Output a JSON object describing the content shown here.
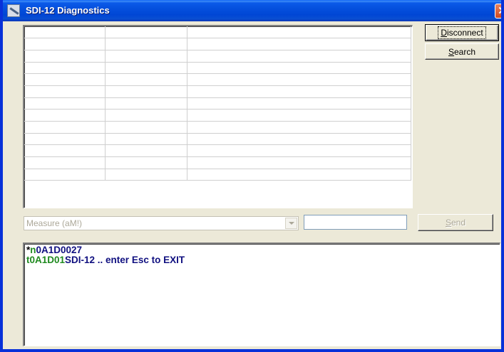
{
  "window": {
    "title": "SDI-12 Diagnostics",
    "close_glyph": "✕",
    "app_icon": "sdi12-app-icon"
  },
  "sensor_grid": {
    "columns": [
      "",
      "",
      ""
    ],
    "rows": 13
  },
  "buttons": {
    "disconnect": {
      "first": "D",
      "rest": "isconnect"
    },
    "search": {
      "first": "S",
      "rest": "earch"
    },
    "send": {
      "first": "S",
      "rest": "end"
    }
  },
  "command": {
    "selected": "Measure (aM!)",
    "parameter_value": ""
  },
  "terminal": {
    "lines": [
      [
        {
          "text": "*",
          "color": "#000000"
        },
        {
          "text": "n",
          "color": "#1f8a1f"
        },
        {
          "text": "0A1D0027",
          "color": "#101080"
        }
      ],
      [
        {
          "text": "t0A1D01",
          "color": "#1f8a1f"
        },
        {
          "text": "SDI-12 .. enter Esc to EXIT",
          "color": "#101080"
        }
      ]
    ]
  },
  "colors": {
    "titlebar": "#0550dd",
    "window_bg": "#ece9d8",
    "close": "#d04a21"
  }
}
